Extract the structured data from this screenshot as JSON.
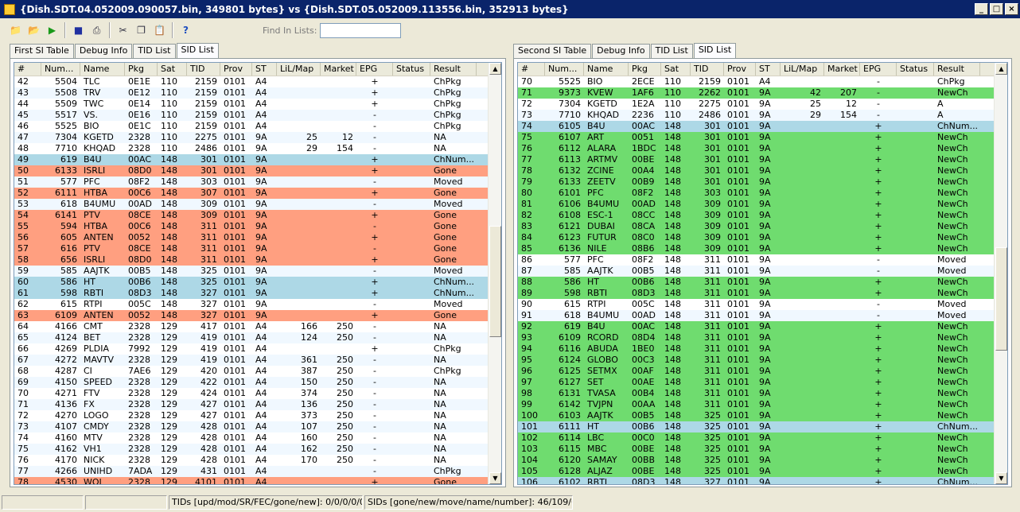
{
  "window": {
    "title": "{Dish.SDT.04.052009.090057.bin, 349801 bytes} vs {Dish.SDT.05.052009.113556.bin, 352913 bytes}"
  },
  "toolbar": {
    "find_label": "Find In Lists:",
    "find_value": ""
  },
  "left": {
    "tabs": [
      "First SI Table",
      "Debug Info",
      "TID List",
      "SID List"
    ],
    "columns": [
      "#",
      "Num...",
      "Name",
      "Pkg",
      "Sat",
      "TID",
      "Prov",
      "ST",
      "LiL/Map",
      "Market",
      "EPG",
      "Status",
      "Result"
    ],
    "rows": [
      [
        "42",
        "5504",
        "TLC",
        "0E1E",
        "110",
        "2159",
        "0101",
        "A4",
        "",
        "",
        "+",
        "",
        "ChPkg",
        ""
      ],
      [
        "43",
        "5508",
        "TRV",
        "0E12",
        "110",
        "2159",
        "0101",
        "A4",
        "",
        "",
        "+",
        "",
        "ChPkg",
        ""
      ],
      [
        "44",
        "5509",
        "TWC",
        "0E14",
        "110",
        "2159",
        "0101",
        "A4",
        "",
        "",
        "+",
        "",
        "ChPkg",
        ""
      ],
      [
        "45",
        "5517",
        "VS.",
        "0E16",
        "110",
        "2159",
        "0101",
        "A4",
        "",
        "",
        "-",
        "",
        "ChPkg",
        ""
      ],
      [
        "46",
        "5525",
        "BIO",
        "0E1C",
        "110",
        "2159",
        "0101",
        "A4",
        "",
        "",
        "-",
        "",
        "ChPkg",
        ""
      ],
      [
        "47",
        "7304",
        "KGETD",
        "2328",
        "110",
        "2275",
        "0101",
        "9A",
        "25",
        "12",
        "-",
        "",
        "NA",
        ""
      ],
      [
        "48",
        "7710",
        "KHQAD",
        "2328",
        "110",
        "2486",
        "0101",
        "9A",
        "29",
        "154",
        "-",
        "",
        "NA",
        ""
      ],
      [
        "49",
        "619",
        "B4U",
        "00AC",
        "148",
        "301",
        "0101",
        "9A",
        "",
        "",
        "+",
        "",
        "ChNum...",
        "blue"
      ],
      [
        "50",
        "6133",
        "ISRLI",
        "08D0",
        "148",
        "301",
        "0101",
        "9A",
        "",
        "",
        "+",
        "",
        "Gone",
        "orange"
      ],
      [
        "51",
        "577",
        "PFC",
        "08F2",
        "148",
        "303",
        "0101",
        "9A",
        "",
        "",
        "-",
        "",
        "Moved",
        ""
      ],
      [
        "52",
        "6111",
        "HTBA",
        "00C6",
        "148",
        "307",
        "0101",
        "9A",
        "",
        "",
        "+",
        "",
        "Gone",
        "orange"
      ],
      [
        "53",
        "618",
        "B4UMU",
        "00AD",
        "148",
        "309",
        "0101",
        "9A",
        "",
        "",
        "-",
        "",
        "Moved",
        ""
      ],
      [
        "54",
        "6141",
        "PTV",
        "08CE",
        "148",
        "309",
        "0101",
        "9A",
        "",
        "",
        "+",
        "",
        "Gone",
        "orange"
      ],
      [
        "55",
        "594",
        "HTBA",
        "00C6",
        "148",
        "311",
        "0101",
        "9A",
        "",
        "",
        "-",
        "",
        "Gone",
        "orange"
      ],
      [
        "56",
        "605",
        "ANTEN",
        "0052",
        "148",
        "311",
        "0101",
        "9A",
        "",
        "",
        "+",
        "",
        "Gone",
        "orange"
      ],
      [
        "57",
        "616",
        "PTV",
        "08CE",
        "148",
        "311",
        "0101",
        "9A",
        "",
        "",
        "-",
        "",
        "Gone",
        "orange"
      ],
      [
        "58",
        "656",
        "ISRLI",
        "08D0",
        "148",
        "311",
        "0101",
        "9A",
        "",
        "",
        "+",
        "",
        "Gone",
        "orange"
      ],
      [
        "59",
        "585",
        "AAJTK",
        "00B5",
        "148",
        "325",
        "0101",
        "9A",
        "",
        "",
        "-",
        "",
        "Moved",
        ""
      ],
      [
        "60",
        "586",
        "HT",
        "00B6",
        "148",
        "325",
        "0101",
        "9A",
        "",
        "",
        "+",
        "",
        "ChNum...",
        "blue"
      ],
      [
        "61",
        "598",
        "RBTI",
        "08D3",
        "148",
        "327",
        "0101",
        "9A",
        "",
        "",
        "+",
        "",
        "ChNum...",
        "blue"
      ],
      [
        "62",
        "615",
        "RTPI",
        "005C",
        "148",
        "327",
        "0101",
        "9A",
        "",
        "",
        "-",
        "",
        "Moved",
        ""
      ],
      [
        "63",
        "6109",
        "ANTEN",
        "0052",
        "148",
        "327",
        "0101",
        "9A",
        "",
        "",
        "+",
        "",
        "Gone",
        "orange"
      ],
      [
        "64",
        "4166",
        "CMT",
        "2328",
        "129",
        "417",
        "0101",
        "A4",
        "166",
        "250",
        "-",
        "",
        "NA",
        ""
      ],
      [
        "65",
        "4124",
        "BET",
        "2328",
        "129",
        "419",
        "0101",
        "A4",
        "124",
        "250",
        "-",
        "",
        "NA",
        ""
      ],
      [
        "66",
        "4269",
        "PLDIA",
        "7992",
        "129",
        "419",
        "0101",
        "A4",
        "",
        "",
        "+",
        "",
        "ChPkg",
        ""
      ],
      [
        "67",
        "4272",
        "MAVTV",
        "2328",
        "129",
        "419",
        "0101",
        "A4",
        "361",
        "250",
        "-",
        "",
        "NA",
        ""
      ],
      [
        "68",
        "4287",
        "CI",
        "7AE6",
        "129",
        "420",
        "0101",
        "A4",
        "387",
        "250",
        "-",
        "",
        "ChPkg",
        ""
      ],
      [
        "69",
        "4150",
        "SPEED",
        "2328",
        "129",
        "422",
        "0101",
        "A4",
        "150",
        "250",
        "-",
        "",
        "NA",
        ""
      ],
      [
        "70",
        "4271",
        "FTV",
        "2328",
        "129",
        "424",
        "0101",
        "A4",
        "374",
        "250",
        "-",
        "",
        "NA",
        ""
      ],
      [
        "71",
        "4136",
        "FX",
        "2328",
        "129",
        "427",
        "0101",
        "A4",
        "136",
        "250",
        "-",
        "",
        "NA",
        ""
      ],
      [
        "72",
        "4270",
        "LOGO",
        "2328",
        "129",
        "427",
        "0101",
        "A4",
        "373",
        "250",
        "-",
        "",
        "NA",
        ""
      ],
      [
        "73",
        "4107",
        "CMDY",
        "2328",
        "129",
        "428",
        "0101",
        "A4",
        "107",
        "250",
        "-",
        "",
        "NA",
        ""
      ],
      [
        "74",
        "4160",
        "MTV",
        "2328",
        "129",
        "428",
        "0101",
        "A4",
        "160",
        "250",
        "-",
        "",
        "NA",
        ""
      ],
      [
        "75",
        "4162",
        "VH1",
        "2328",
        "129",
        "428",
        "0101",
        "A4",
        "162",
        "250",
        "-",
        "",
        "NA",
        ""
      ],
      [
        "76",
        "4170",
        "NICK",
        "2328",
        "129",
        "428",
        "0101",
        "A4",
        "170",
        "250",
        "-",
        "",
        "NA",
        ""
      ],
      [
        "77",
        "4266",
        "UNIHD",
        "7ADA",
        "129",
        "431",
        "0101",
        "A4",
        "",
        "",
        "-",
        "",
        "ChPkg",
        ""
      ],
      [
        "78",
        "4530",
        "WOI",
        "2328",
        "129",
        "4101",
        "0101",
        "A4",
        "",
        "",
        "+",
        "",
        "Gone",
        "orange"
      ]
    ]
  },
  "right": {
    "tabs": [
      "Second SI Table",
      "Debug Info",
      "TID List",
      "SID List"
    ],
    "columns": [
      "#",
      "Num...",
      "Name",
      "Pkg",
      "Sat",
      "TID",
      "Prov",
      "ST",
      "LiL/Map",
      "Market",
      "EPG",
      "Status",
      "Result"
    ],
    "rows": [
      [
        "70",
        "5525",
        "BIO",
        "2ECE",
        "110",
        "2159",
        "0101",
        "A4",
        "",
        "",
        "-",
        "",
        "ChPkg",
        ""
      ],
      [
        "71",
        "9373",
        "KVEW",
        "1AF6",
        "110",
        "2262",
        "0101",
        "9A",
        "42",
        "207",
        "-",
        "",
        "NewCh",
        "green"
      ],
      [
        "72",
        "7304",
        "KGETD",
        "1E2A",
        "110",
        "2275",
        "0101",
        "9A",
        "25",
        "12",
        "-",
        "",
        "A",
        ""
      ],
      [
        "73",
        "7710",
        "KHQAD",
        "2236",
        "110",
        "2486",
        "0101",
        "9A",
        "29",
        "154",
        "-",
        "",
        "A",
        ""
      ],
      [
        "74",
        "6105",
        "B4U",
        "00AC",
        "148",
        "301",
        "0101",
        "9A",
        "",
        "",
        "+",
        "",
        "ChNum...",
        "blue"
      ],
      [
        "75",
        "6107",
        "ART",
        "0051",
        "148",
        "301",
        "0101",
        "9A",
        "",
        "",
        "+",
        "",
        "NewCh",
        "green"
      ],
      [
        "76",
        "6112",
        "ALARA",
        "1BDC",
        "148",
        "301",
        "0101",
        "9A",
        "",
        "",
        "+",
        "",
        "NewCh",
        "green"
      ],
      [
        "77",
        "6113",
        "ARTMV",
        "00BE",
        "148",
        "301",
        "0101",
        "9A",
        "",
        "",
        "+",
        "",
        "NewCh",
        "green"
      ],
      [
        "78",
        "6132",
        "ZCINE",
        "00A4",
        "148",
        "301",
        "0101",
        "9A",
        "",
        "",
        "+",
        "",
        "NewCh",
        "green"
      ],
      [
        "79",
        "6133",
        "ZEETV",
        "00B9",
        "148",
        "301",
        "0101",
        "9A",
        "",
        "",
        "+",
        "",
        "NewCh",
        "green"
      ],
      [
        "80",
        "6101",
        "PFC",
        "08F2",
        "148",
        "303",
        "0101",
        "9A",
        "",
        "",
        "+",
        "",
        "NewCh",
        "green"
      ],
      [
        "81",
        "6106",
        "B4UMU",
        "00AD",
        "148",
        "309",
        "0101",
        "9A",
        "",
        "",
        "+",
        "",
        "NewCh",
        "green"
      ],
      [
        "82",
        "6108",
        "ESC-1",
        "08CC",
        "148",
        "309",
        "0101",
        "9A",
        "",
        "",
        "+",
        "",
        "NewCh",
        "green"
      ],
      [
        "83",
        "6121",
        "DUBAI",
        "08CA",
        "148",
        "309",
        "0101",
        "9A",
        "",
        "",
        "+",
        "",
        "NewCh",
        "green"
      ],
      [
        "84",
        "6123",
        "FUTUR",
        "08C0",
        "148",
        "309",
        "0101",
        "9A",
        "",
        "",
        "+",
        "",
        "NewCh",
        "green"
      ],
      [
        "85",
        "6136",
        "NILE",
        "08B6",
        "148",
        "309",
        "0101",
        "9A",
        "",
        "",
        "+",
        "",
        "NewCh",
        "green"
      ],
      [
        "86",
        "577",
        "PFC",
        "08F2",
        "148",
        "311",
        "0101",
        "9A",
        "",
        "",
        "-",
        "",
        "Moved",
        ""
      ],
      [
        "87",
        "585",
        "AAJTK",
        "00B5",
        "148",
        "311",
        "0101",
        "9A",
        "",
        "",
        "-",
        "",
        "Moved",
        ""
      ],
      [
        "88",
        "586",
        "HT",
        "00B6",
        "148",
        "311",
        "0101",
        "9A",
        "",
        "",
        "+",
        "",
        "NewCh",
        "green"
      ],
      [
        "89",
        "598",
        "RBTI",
        "08D3",
        "148",
        "311",
        "0101",
        "9A",
        "",
        "",
        "+",
        "",
        "NewCh",
        "green"
      ],
      [
        "90",
        "615",
        "RTPI",
        "005C",
        "148",
        "311",
        "0101",
        "9A",
        "",
        "",
        "-",
        "",
        "Moved",
        ""
      ],
      [
        "91",
        "618",
        "B4UMU",
        "00AD",
        "148",
        "311",
        "0101",
        "9A",
        "",
        "",
        "-",
        "",
        "Moved",
        ""
      ],
      [
        "92",
        "619",
        "B4U",
        "00AC",
        "148",
        "311",
        "0101",
        "9A",
        "",
        "",
        "+",
        "",
        "NewCh",
        "green"
      ],
      [
        "93",
        "6109",
        "RCORD",
        "08D4",
        "148",
        "311",
        "0101",
        "9A",
        "",
        "",
        "+",
        "",
        "NewCh",
        "green"
      ],
      [
        "94",
        "6116",
        "ABUDA",
        "1BE0",
        "148",
        "311",
        "0101",
        "9A",
        "",
        "",
        "+",
        "",
        "NewCh",
        "green"
      ],
      [
        "95",
        "6124",
        "GLOBO",
        "00C3",
        "148",
        "311",
        "0101",
        "9A",
        "",
        "",
        "+",
        "",
        "NewCh",
        "green"
      ],
      [
        "96",
        "6125",
        "SETMX",
        "00AF",
        "148",
        "311",
        "0101",
        "9A",
        "",
        "",
        "+",
        "",
        "NewCh",
        "green"
      ],
      [
        "97",
        "6127",
        "SET",
        "00AE",
        "148",
        "311",
        "0101",
        "9A",
        "",
        "",
        "+",
        "",
        "NewCh",
        "green"
      ],
      [
        "98",
        "6131",
        "TVASA",
        "00B4",
        "148",
        "311",
        "0101",
        "9A",
        "",
        "",
        "+",
        "",
        "NewCh",
        "green"
      ],
      [
        "99",
        "6142",
        "TVJPN",
        "00AA",
        "148",
        "311",
        "0101",
        "9A",
        "",
        "",
        "+",
        "",
        "NewCh",
        "green"
      ],
      [
        "100",
        "6103",
        "AAJTK",
        "00B5",
        "148",
        "325",
        "0101",
        "9A",
        "",
        "",
        "+",
        "",
        "NewCh",
        "green"
      ],
      [
        "101",
        "6111",
        "HT",
        "00B6",
        "148",
        "325",
        "0101",
        "9A",
        "",
        "",
        "+",
        "",
        "ChNum...",
        "blue"
      ],
      [
        "102",
        "6114",
        "LBC",
        "00C0",
        "148",
        "325",
        "0101",
        "9A",
        "",
        "",
        "+",
        "",
        "NewCh",
        "green"
      ],
      [
        "103",
        "6115",
        "MBC",
        "00BE",
        "148",
        "325",
        "0101",
        "9A",
        "",
        "",
        "+",
        "",
        "NewCh",
        "green"
      ],
      [
        "104",
        "6120",
        "SAMAY",
        "00BB",
        "148",
        "325",
        "0101",
        "9A",
        "",
        "",
        "+",
        "",
        "NewCh",
        "green"
      ],
      [
        "105",
        "6128",
        "ALJAZ",
        "00BE",
        "148",
        "325",
        "0101",
        "9A",
        "",
        "",
        "+",
        "",
        "NewCh",
        "green"
      ],
      [
        "106",
        "6102",
        "RBTI",
        "08D3",
        "148",
        "327",
        "0101",
        "9A",
        "",
        "",
        "+",
        "",
        "ChNum...",
        "blue"
      ]
    ]
  },
  "status": {
    "tids": "TIDs [upd/mod/SR/FEC/gone/new]: 0/0/0/0/0/0",
    "sids": "SIDs [gone/new/move/name/number]: 46/109/6/4/3"
  }
}
